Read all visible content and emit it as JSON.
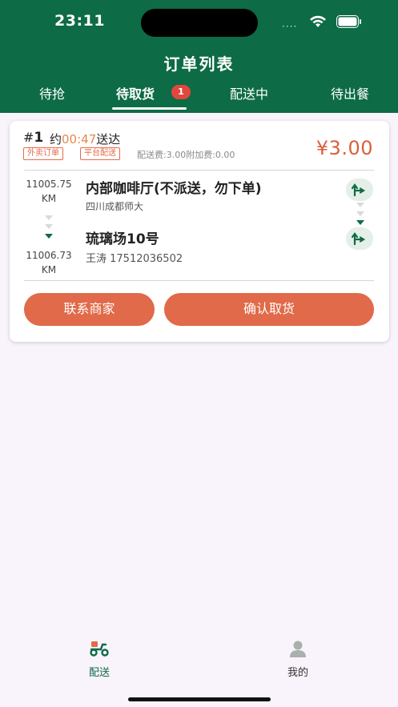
{
  "status_bar": {
    "time": "23:11",
    "dots": "····"
  },
  "nav": {
    "title": "订单列表"
  },
  "tabs": [
    {
      "label": "待抢"
    },
    {
      "label": "待取货",
      "badge": "1",
      "active": true
    },
    {
      "label": "配送中"
    },
    {
      "label": "待出餐"
    }
  ],
  "order": {
    "number_prefix": "#",
    "number": "1",
    "eta_prefix": "约",
    "eta_time": "00:47",
    "eta_suffix": "送达",
    "tags": [
      "外卖订单",
      "平台配送"
    ],
    "fees": "配送费:3.00附加费:0.00",
    "price": "¥3.00",
    "pickup": {
      "distance_value": "11005.75",
      "distance_unit": "KM",
      "name": "内部咖啡厅(不派送，勿下单)",
      "address": "四川成都师大"
    },
    "dropoff": {
      "distance_value": "11006.73",
      "distance_unit": "KM",
      "name": "琉璃场10号",
      "contact": "王涛 17512036502"
    },
    "buttons": {
      "contact_merchant": "联系商家",
      "confirm_pickup": "确认取货"
    }
  },
  "bottom_nav": [
    {
      "label": "配送",
      "icon": "scooter-icon",
      "active": true
    },
    {
      "label": "我的",
      "icon": "user-icon",
      "active": false
    }
  ],
  "colors": {
    "primary": "#0d6b45",
    "accent": "#e06a49",
    "price": "#d9603c",
    "badge": "#e2473f"
  }
}
